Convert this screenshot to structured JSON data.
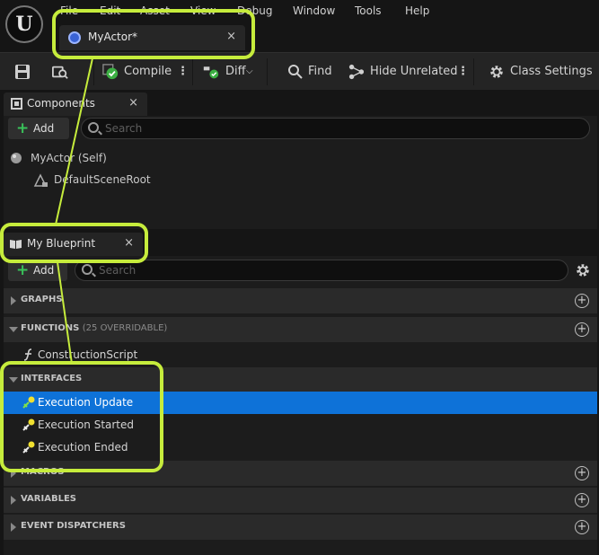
{
  "menu": [
    "File",
    "Edit",
    "Asset",
    "View",
    "Debug",
    "Window",
    "Tools",
    "Help"
  ],
  "asset_tab": {
    "label": "MyActor*",
    "close": "×"
  },
  "toolbar": {
    "compile": "Compile",
    "diff": "Diff",
    "find": "Find",
    "hide_unrelated": "Hide Unrelated",
    "class_settings": "Class Settings"
  },
  "components": {
    "tab_label": "Components",
    "close": "×",
    "add_label": "Add",
    "search_placeholder": "Search",
    "tree": [
      "MyActor (Self)",
      "DefaultSceneRoot"
    ]
  },
  "blueprint": {
    "tab_label": "My Blueprint",
    "close": "×",
    "add_label": "Add",
    "search_placeholder": "Search",
    "sections": {
      "graphs": "GRAPHS",
      "functions": "FUNCTIONS",
      "functions_sub": "(25 OVERRIDABLE)",
      "interfaces": "INTERFACES",
      "macros": "MACROS",
      "variables": "VARIABLES",
      "event_dispatchers": "EVENT DISPATCHERS"
    },
    "functions_items": [
      "ConstructionScript"
    ],
    "interfaces_items": [
      "Execution Update",
      "Execution Started",
      "Execution Ended"
    ]
  },
  "colors": {
    "highlight": "#c6ec3c",
    "selection": "#0e72d8",
    "add_green": "#39c25a"
  }
}
